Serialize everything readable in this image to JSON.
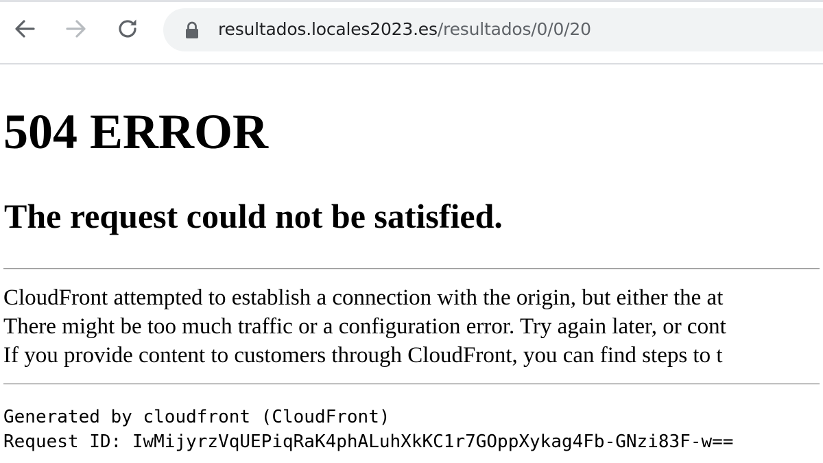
{
  "browser": {
    "url_host": "resultados.locales2023.es",
    "url_path": "/resultados/0/0/20",
    "icons": {
      "back": "arrow-left-icon",
      "forward": "arrow-right-icon",
      "reload": "reload-icon",
      "lock": "lock-icon"
    },
    "colors": {
      "omnibox_bg": "#f1f3f4",
      "host_text": "#202124",
      "path_text": "#5f6368"
    }
  },
  "error_page": {
    "title": "504 ERROR",
    "subtitle": "The request could not be satisfied.",
    "message_lines": [
      "CloudFront attempted to establish a connection with the origin, but either the at",
      "There might be too much traffic or a configuration error. Try again later, or cont",
      "If you provide content to customers through CloudFront, you can find steps to t"
    ],
    "generated_by": "Generated by cloudfront (CloudFront)",
    "request_id": "Request ID: IwMijyrzVqUEPiqRaK4phALuhXkKC1r7GOppXykag4Fb-GNzi83F-w=="
  }
}
